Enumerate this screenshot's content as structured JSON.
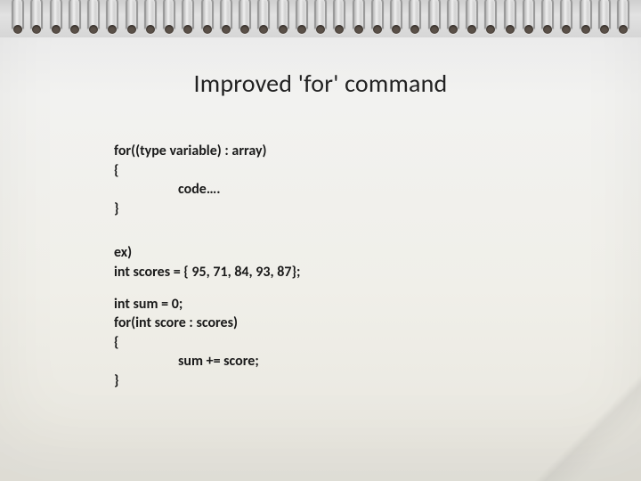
{
  "title": "Improved 'for' command",
  "syntax": {
    "l1": "for((type variable) : array)",
    "l2": "{",
    "l3": "code….",
    "l4": "}"
  },
  "example": {
    "l1": "ex)",
    "l2": "int scores = { 95, 71, 84, 93, 87};",
    "l3": "int sum = 0;",
    "l4": "for(int score : scores)",
    "l5": "{",
    "l6": "sum += score;",
    "l7": "}"
  }
}
